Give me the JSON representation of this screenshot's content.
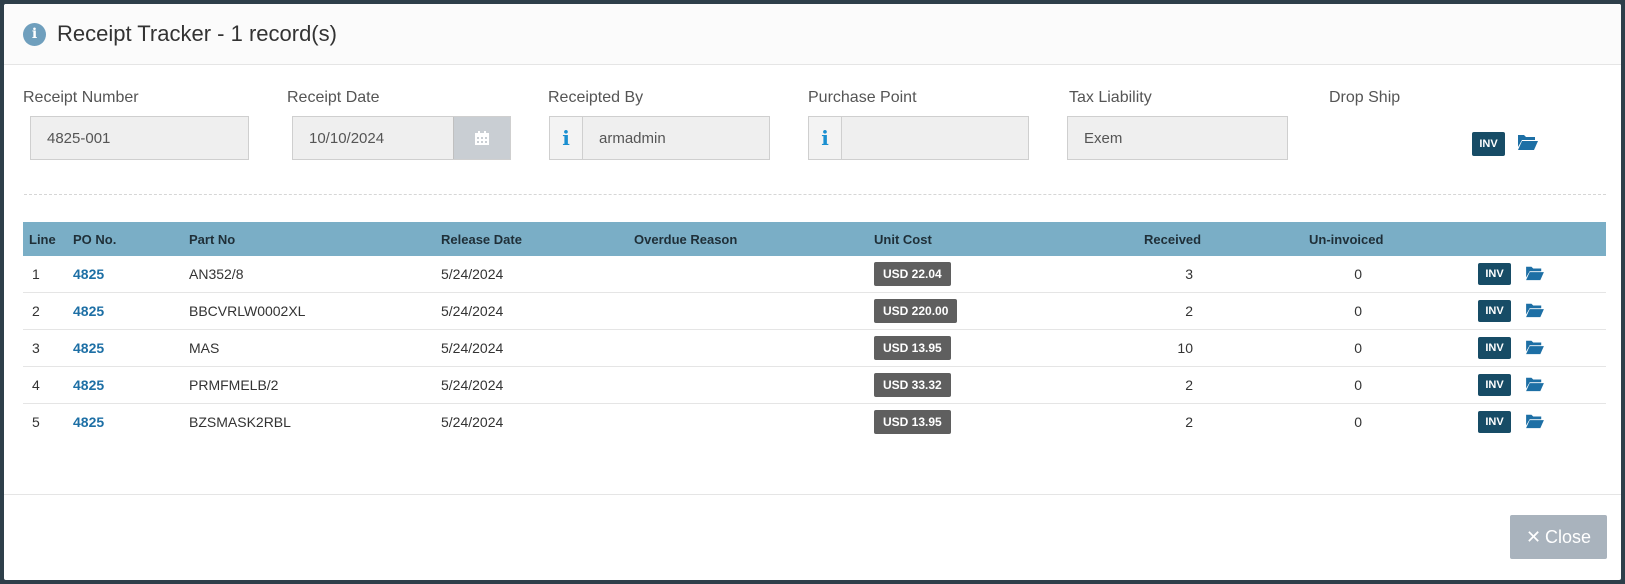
{
  "header": {
    "title": "Receipt Tracker - 1 record(s)",
    "icon": "info-icon"
  },
  "fields": {
    "receipt_number": {
      "label": "Receipt Number",
      "value": "4825-001"
    },
    "receipt_date": {
      "label": "Receipt Date",
      "value": "10/10/2024"
    },
    "receipted_by": {
      "label": "Receipted By",
      "value": "armadmin"
    },
    "purchase_point": {
      "label": "Purchase Point",
      "value": ""
    },
    "tax_liability": {
      "label": "Tax Liability",
      "value": "Exem"
    },
    "drop_ship": {
      "label": "Drop Ship",
      "inv_label": "INV"
    }
  },
  "table": {
    "columns": [
      "Line",
      "PO No.",
      "Part No",
      "Release Date",
      "Overdue Reason",
      "Unit Cost",
      "Received",
      "Un-invoiced"
    ],
    "rows": [
      {
        "line": "1",
        "po": "4825",
        "part": "AN352/8",
        "release": "5/24/2024",
        "reason": "",
        "cost": "USD 22.04",
        "received": "3",
        "uninvoiced": "0",
        "inv": "INV"
      },
      {
        "line": "2",
        "po": "4825",
        "part": "BBCVRLW0002XL",
        "release": "5/24/2024",
        "reason": "",
        "cost": "USD 220.00",
        "received": "2",
        "uninvoiced": "0",
        "inv": "INV"
      },
      {
        "line": "3",
        "po": "4825",
        "part": "MAS",
        "release": "5/24/2024",
        "reason": "",
        "cost": "USD 13.95",
        "received": "10",
        "uninvoiced": "0",
        "inv": "INV"
      },
      {
        "line": "4",
        "po": "4825",
        "part": "PRMFMELB/2",
        "release": "5/24/2024",
        "reason": "",
        "cost": "USD 33.32",
        "received": "2",
        "uninvoiced": "0",
        "inv": "INV"
      },
      {
        "line": "5",
        "po": "4825",
        "part": "BZSMASK2RBL",
        "release": "5/24/2024",
        "reason": "",
        "cost": "USD 13.95",
        "received": "2",
        "uninvoiced": "0",
        "inv": "INV"
      }
    ]
  },
  "footer": {
    "close_label": "Close"
  },
  "colors": {
    "header_row": "#7aaec6",
    "inv_badge": "#174c66",
    "link": "#1d6fa5",
    "folder": "#1d6fa5",
    "cost_badge": "#5f5f5f",
    "close_button": "#a9b3bd"
  }
}
